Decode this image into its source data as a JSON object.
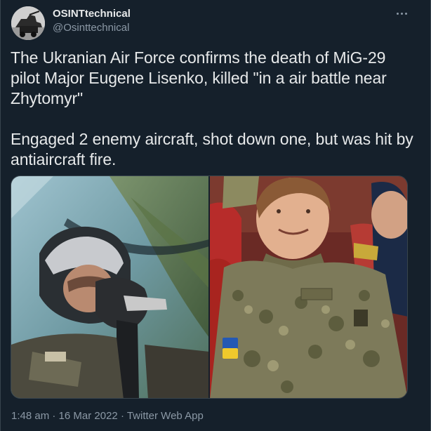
{
  "author": {
    "name": "OSINTtechnical",
    "handle": "@Osinttechnical"
  },
  "more_icon": "more-horizontal-icon",
  "tweet": {
    "paragraphs": [
      "The Ukranian Air Force confirms the death of MiG-29 pilot Major Eugene Lisenko, killed \"in a air battle near Zhytomyr\"",
      "Engaged 2 enemy aircraft, shot down one, but was hit by antiaircraft fire."
    ]
  },
  "meta": {
    "time": "1:48 am",
    "separator": " · ",
    "date": "16 Mar 2022",
    "source": "Twitter Web App"
  },
  "colors": {
    "background": "#15202b",
    "text": "#e7e9ea",
    "secondary": "#8b98a5",
    "border": "#38444d"
  }
}
